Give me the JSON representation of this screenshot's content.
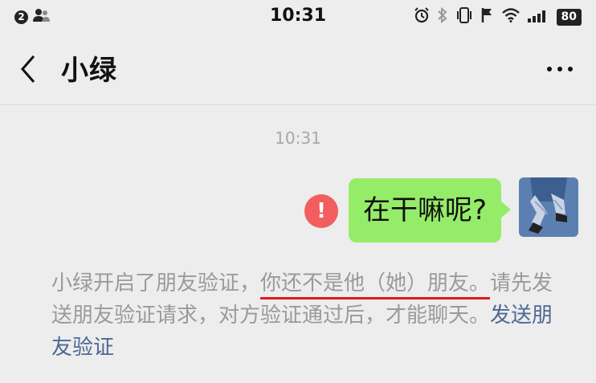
{
  "status_bar": {
    "notification_count": "2",
    "time": "10:31",
    "battery": "80",
    "icons": [
      "person-icon",
      "alarm-icon",
      "bluetooth-icon",
      "vibrate-icon",
      "flag-icon",
      "wifi-icon",
      "signal-icon"
    ]
  },
  "header": {
    "title": "小绿",
    "back_icon": "chevron-left-icon",
    "more_icon": "more-horizontal-icon"
  },
  "chat": {
    "timestamp": "10:31",
    "messages": [
      {
        "sender": "me",
        "text": "在干嘛呢?",
        "status": "failed"
      }
    ],
    "system_message": {
      "part1": "小绿开启了朋友验证，",
      "part2_underlined": "你还不是他（她）朋友。",
      "part3": "请先发送朋友验证请求，对方验证通过后，才能聊天。",
      "link": "发送朋友验证"
    }
  },
  "colors": {
    "background": "#ededed",
    "bubble_green": "#95ec69",
    "error_red": "#f25d5d",
    "link_blue": "#4d6895",
    "underline_red": "#e21a1a"
  }
}
